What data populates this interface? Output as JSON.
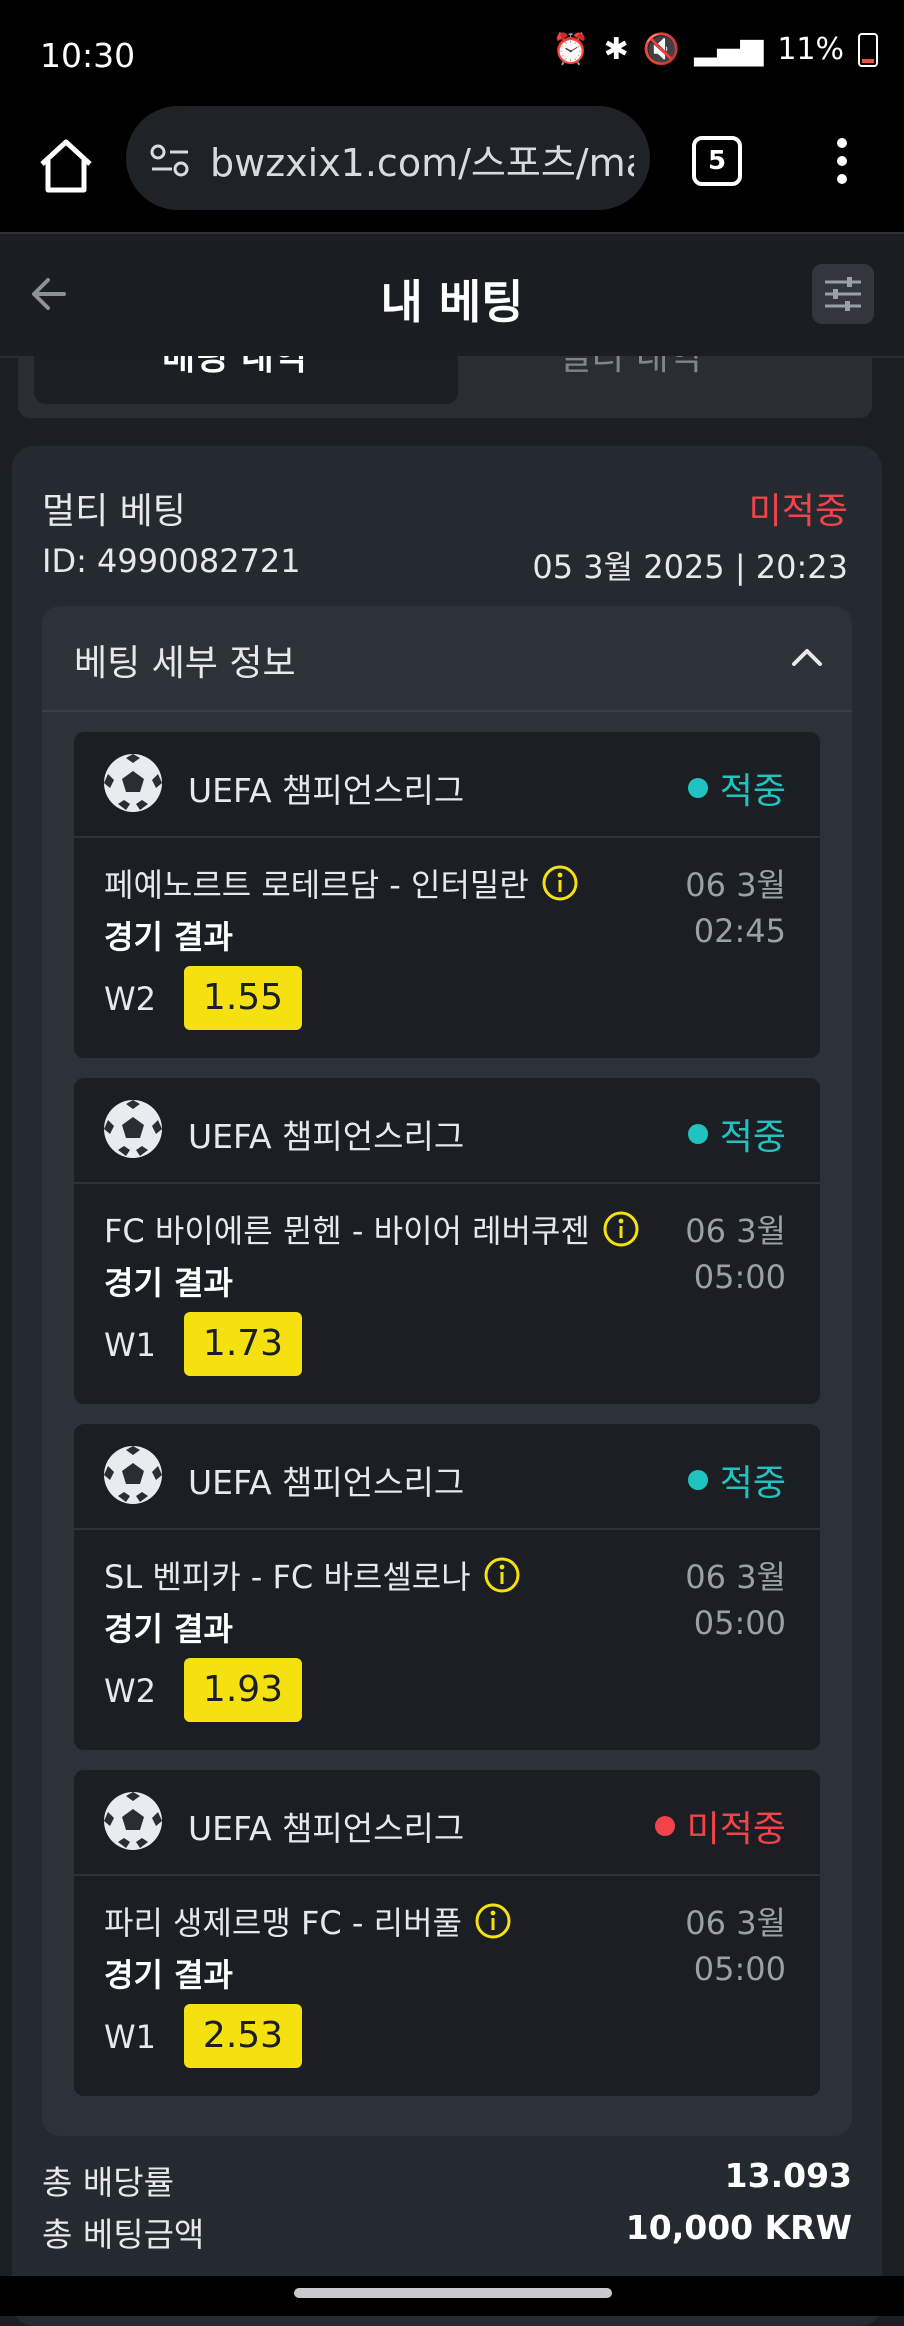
{
  "status_bar": {
    "time": "10:30",
    "battery": "11%"
  },
  "browser": {
    "url": "bwzxix1.com/스포츠/ma",
    "tab_count": "5"
  },
  "header": {
    "title": "내 베팅"
  },
  "tabs": [
    {
      "label": "배팅 내역"
    },
    {
      "label": "멀티 내역"
    }
  ],
  "bet": {
    "type": "멀티 베팅",
    "status": "미적중",
    "status_color": "#f0434a",
    "id": "ID: 4990082721",
    "date": "05 3월 2025 | 20:23",
    "details_title": "베팅 세부 정보",
    "matches": [
      {
        "league": "UEFA 챔피언스리그",
        "result": "적중",
        "result_color": "#21c3c1",
        "teams": "페예노르트 로테르담 - 인터밀란",
        "date": "06 3월",
        "time": "02:45",
        "market": "경기 결과",
        "outcome": "W2",
        "odds": "1.55"
      },
      {
        "league": "UEFA 챔피언스리그",
        "result": "적중",
        "result_color": "#21c3c1",
        "teams": "FC 바이에른 뮌헨 - 바이어 레버쿠젠",
        "date": "06 3월",
        "time": "05:00",
        "market": "경기 결과",
        "outcome": "W1",
        "odds": "1.73"
      },
      {
        "league": "UEFA 챔피언스리그",
        "result": "적중",
        "result_color": "#21c3c1",
        "teams": "SL 벤피카 - FC 바르셀로나",
        "date": "06 3월",
        "time": "05:00",
        "market": "경기 결과",
        "outcome": "W2",
        "odds": "1.93"
      },
      {
        "league": "UEFA 챔피언스리그",
        "result": "미적중",
        "result_color": "#f0434a",
        "teams": "파리 생제르맹 FC - 리버풀",
        "date": "06 3월",
        "time": "05:00",
        "market": "경기 결과",
        "outcome": "W1",
        "odds": "2.53"
      }
    ],
    "totals": [
      {
        "label": "총 배당률",
        "value": "13.093"
      },
      {
        "label": "총 베팅금액",
        "value": "10,000 KRW"
      }
    ]
  },
  "colors": {
    "odds_bg": "#f5e10f",
    "accent_win": "#21c3c1",
    "accent_loss": "#f0434a"
  }
}
